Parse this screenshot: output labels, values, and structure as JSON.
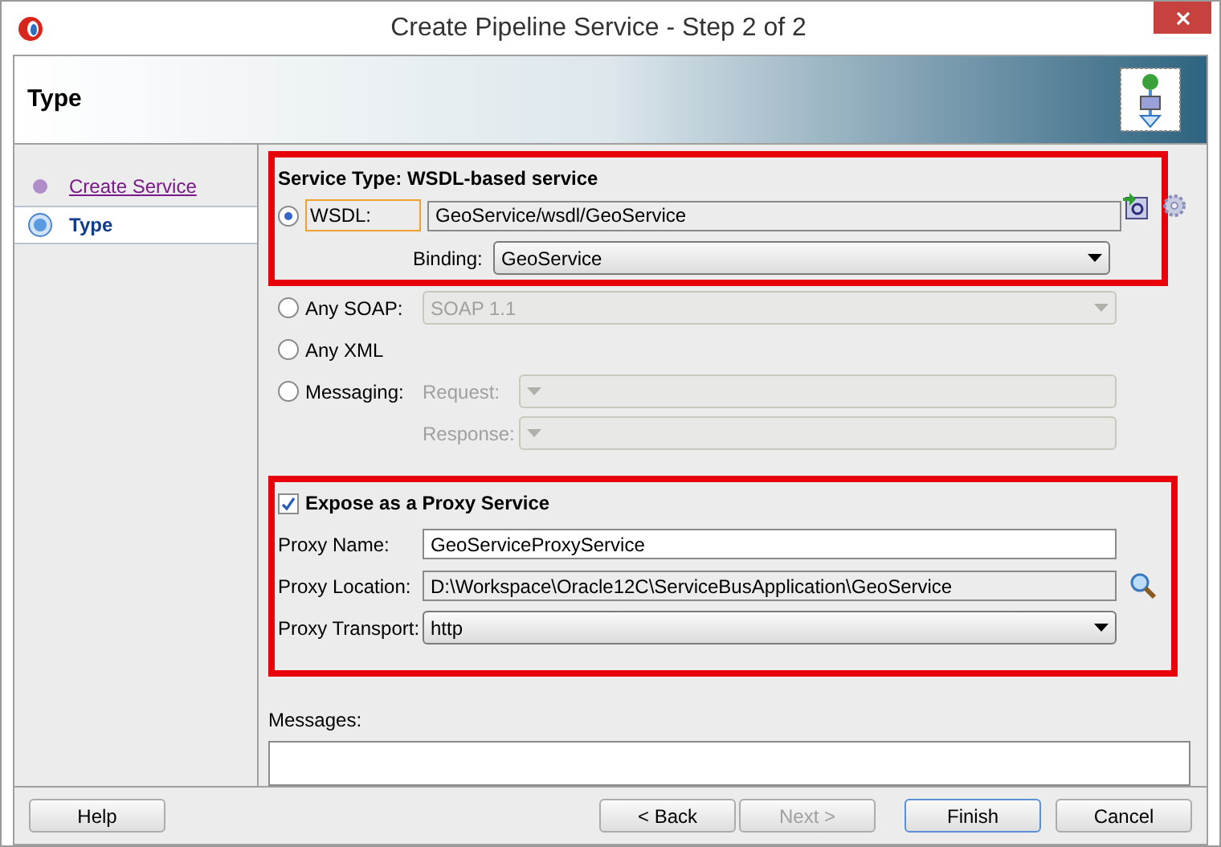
{
  "window": {
    "title": "Create Pipeline Service - Step 2 of 2"
  },
  "header": {
    "title": "Type"
  },
  "steps": [
    {
      "label": "Create Service",
      "selected": false
    },
    {
      "label": "Type",
      "selected": true
    }
  ],
  "service_type": {
    "heading": "Service Type: WSDL-based service",
    "options": [
      {
        "label": "WSDL:",
        "selected": true,
        "kind": "wsdl",
        "value": "GeoService/wsdl/GeoService",
        "binding_label": "Binding:",
        "binding_value": "GeoService"
      },
      {
        "label": "Any SOAP:",
        "selected": false,
        "kind": "select",
        "value": "SOAP 1.1",
        "disabled": true
      },
      {
        "label": "Any XML",
        "selected": false,
        "kind": "plain"
      },
      {
        "label": "Messaging:",
        "selected": false,
        "kind": "messaging",
        "request_label": "Request:",
        "response_label": "Response:",
        "disabled": true
      }
    ]
  },
  "proxy": {
    "label": "Expose as a Proxy Service",
    "checked": true,
    "fields": [
      {
        "label": "Proxy Name:",
        "kind": "text",
        "value": "GeoServiceProxyService"
      },
      {
        "label": "Proxy Location:",
        "kind": "readonly",
        "value": "D:\\Workspace\\Oracle12C\\ServiceBusApplication\\GeoService"
      },
      {
        "label": "Proxy Transport:",
        "kind": "select",
        "value": "http"
      }
    ]
  },
  "messages": {
    "label": "Messages:"
  },
  "buttons": [
    {
      "label": "Help",
      "disabled": false,
      "default": false
    },
    {
      "label": "< Back",
      "disabled": false,
      "default": false
    },
    {
      "label": "Next >",
      "disabled": true,
      "default": false
    },
    {
      "label": "Finish",
      "disabled": false,
      "default": true
    },
    {
      "label": "Cancel",
      "disabled": false,
      "default": false
    }
  ]
}
